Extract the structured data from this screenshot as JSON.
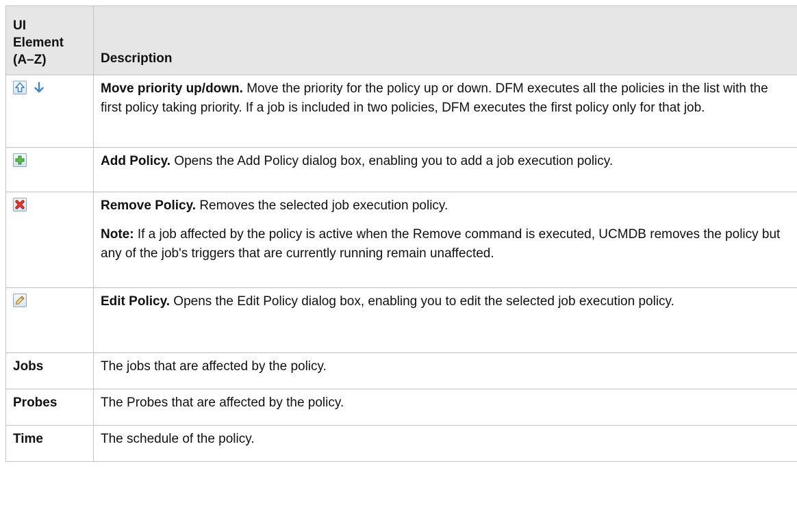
{
  "table": {
    "header": {
      "ui_element_line1": "UI",
      "ui_element_line2": "Element",
      "ui_element_line3": "(A–Z)",
      "description": "Description"
    },
    "rows": {
      "move": {
        "icons": [
          "priority-up-icon",
          "priority-down-icon"
        ],
        "name": "Move priority up/down.",
        "text": " Move the priority for the policy up or down. DFM executes all the policies in the list with the first policy taking priority. If a job is included in two policies, DFM executes the first policy only for that job."
      },
      "add": {
        "icons": [
          "add-policy-icon"
        ],
        "name": "Add Policy.",
        "text": " Opens the Add Policy dialog box, enabling you to add a job execution policy."
      },
      "remove": {
        "icons": [
          "remove-policy-icon"
        ],
        "name": "Remove Policy.",
        "text": " Removes the selected job execution policy.",
        "note_label": "Note:",
        "note_text": " If a job affected by the policy is active when the Remove command is executed, UCMDB removes the policy but any of the job's triggers that are currently running remain unaffected."
      },
      "edit": {
        "icons": [
          "edit-policy-icon"
        ],
        "name": "Edit Policy.",
        "text": " Opens the Edit Policy dialog box, enabling you to edit the selected job execution policy."
      },
      "jobs": {
        "name": "Jobs",
        "text": "The jobs that are affected by the policy."
      },
      "probes": {
        "name": "Probes",
        "text": "The Probes that are affected by the policy."
      },
      "time": {
        "name": "Time",
        "text": "The schedule of the policy."
      }
    }
  },
  "colors": {
    "header_bg": "#e6e6e6",
    "border": "#c4c4c4",
    "icon_blue": "#3f86c9",
    "icon_green": "#3aa33a",
    "icon_red": "#d6241b"
  }
}
